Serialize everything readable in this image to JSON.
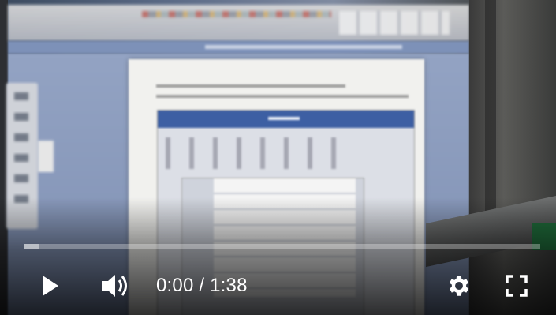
{
  "player": {
    "current_time": "0:00",
    "separator": " / ",
    "duration": "1:38",
    "played_fraction": 0,
    "loaded_fraction": 0.03,
    "colors": {
      "played": "#ff0000",
      "controls": "#ffffff"
    }
  },
  "icons": {
    "play": "play-icon",
    "volume": "volume-icon",
    "settings": "gear-icon",
    "fullscreen": "fullscreen-icon"
  }
}
